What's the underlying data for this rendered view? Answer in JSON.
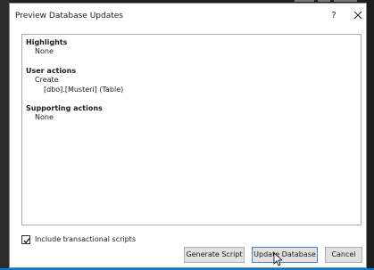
{
  "dialog": {
    "title": "Preview Database Updates",
    "help_label": "?"
  },
  "details": {
    "highlights_heading": "Highlights",
    "highlights_value": "None",
    "user_actions_heading": "User actions",
    "user_actions_action": "Create",
    "user_actions_object": "[dbo].[Musteri] (Table)",
    "supporting_actions_heading": "Supporting actions",
    "supporting_actions_value": "None"
  },
  "options": {
    "include_transactional_label": "Include transactional scripts",
    "include_transactional_checked": true
  },
  "buttons": {
    "generate_script": "Generate Script",
    "update_database": "Update Database",
    "cancel": "Cancel"
  },
  "colors": {
    "primary_border": "#4a7fc6",
    "taskbar_accent": "#0078d4"
  },
  "icons": {
    "close": "close-icon",
    "check": "checkmark-icon",
    "cursor": "mouse-pointer-icon"
  }
}
